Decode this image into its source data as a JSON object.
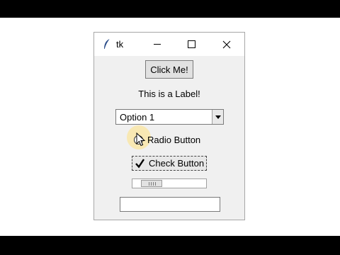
{
  "window": {
    "title": "tk",
    "icon": "feather-icon"
  },
  "titlebar_controls": {
    "minimize_icon": "minimize-icon",
    "maximize_icon": "maximize-icon",
    "close_icon": "close-icon",
    "close_glyph": "✕"
  },
  "widgets": {
    "button_label": "Click Me!",
    "label_text": "This is a Label!",
    "combobox": {
      "selected": "Option 1",
      "arrow_glyph": "▼"
    },
    "radio_label": "Radio Button",
    "radio_selected": false,
    "check_label": "Check Button",
    "check_glyph": "✔",
    "check_checked": true,
    "scale_value_fraction": 0.15,
    "entry_value": "",
    "entry_placeholder": ""
  },
  "colors": {
    "window_bg": "#f0f0f0",
    "titlebar_bg": "#ffffff",
    "button_bg": "#e1e1e1",
    "cursor_highlight": "#ffe282"
  }
}
